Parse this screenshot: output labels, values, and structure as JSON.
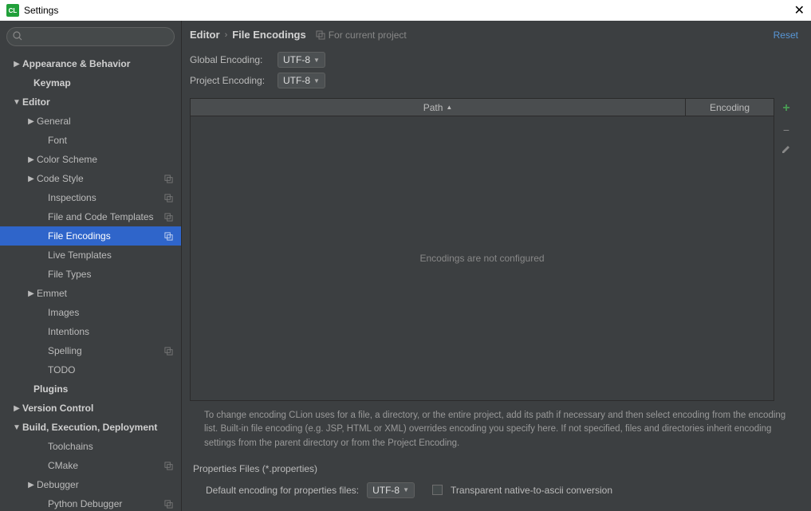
{
  "titlebar": {
    "title": "Settings"
  },
  "search": {
    "placeholder": ""
  },
  "tree": [
    {
      "label": "Appearance & Behavior",
      "expand": "right",
      "indent": 14,
      "bold": true
    },
    {
      "label": "Keymap",
      "expand": "",
      "indent": 28,
      "bold": true
    },
    {
      "label": "Editor",
      "expand": "down",
      "indent": 14,
      "bold": true
    },
    {
      "label": "General",
      "expand": "right",
      "indent": 32
    },
    {
      "label": "Font",
      "expand": "",
      "indent": 46
    },
    {
      "label": "Color Scheme",
      "expand": "right",
      "indent": 32
    },
    {
      "label": "Code Style",
      "expand": "right",
      "indent": 32,
      "badge": true
    },
    {
      "label": "Inspections",
      "expand": "",
      "indent": 46,
      "badge": true
    },
    {
      "label": "File and Code Templates",
      "expand": "",
      "indent": 46,
      "badge": true
    },
    {
      "label": "File Encodings",
      "expand": "",
      "indent": 46,
      "badge": true,
      "selected": true
    },
    {
      "label": "Live Templates",
      "expand": "",
      "indent": 46
    },
    {
      "label": "File Types",
      "expand": "",
      "indent": 46
    },
    {
      "label": "Emmet",
      "expand": "right",
      "indent": 32
    },
    {
      "label": "Images",
      "expand": "",
      "indent": 46
    },
    {
      "label": "Intentions",
      "expand": "",
      "indent": 46
    },
    {
      "label": "Spelling",
      "expand": "",
      "indent": 46,
      "badge": true
    },
    {
      "label": "TODO",
      "expand": "",
      "indent": 46
    },
    {
      "label": "Plugins",
      "expand": "",
      "indent": 28,
      "bold": true
    },
    {
      "label": "Version Control",
      "expand": "right",
      "indent": 14,
      "bold": true
    },
    {
      "label": "Build, Execution, Deployment",
      "expand": "down",
      "indent": 14,
      "bold": true
    },
    {
      "label": "Toolchains",
      "expand": "",
      "indent": 46
    },
    {
      "label": "CMake",
      "expand": "",
      "indent": 46,
      "badge": true
    },
    {
      "label": "Debugger",
      "expand": "right",
      "indent": 32
    },
    {
      "label": "Python Debugger",
      "expand": "",
      "indent": 46,
      "badge": true
    }
  ],
  "breadcrumb": {
    "part1": "Editor",
    "part2": "File Encodings",
    "hint": "For current project"
  },
  "reset": "Reset",
  "encodings": {
    "global_label": "Global Encoding:",
    "global_value": "UTF-8",
    "project_label": "Project Encoding:",
    "project_value": "UTF-8"
  },
  "table": {
    "path_header": "Path",
    "encoding_header": "Encoding",
    "empty": "Encodings are not configured"
  },
  "help_text": "To change encoding CLion uses for a file, a directory, or the entire project, add its path if necessary and then select encoding from the encoding list. Built-in file encoding (e.g. JSP, HTML or XML) overrides encoding you specify here. If not specified, files and directories inherit encoding settings from the parent directory or from the Project Encoding.",
  "properties": {
    "section_title": "Properties Files (*.properties)",
    "default_label": "Default encoding for properties files:",
    "default_value": "UTF-8",
    "transparent_label": "Transparent native-to-ascii conversion"
  }
}
